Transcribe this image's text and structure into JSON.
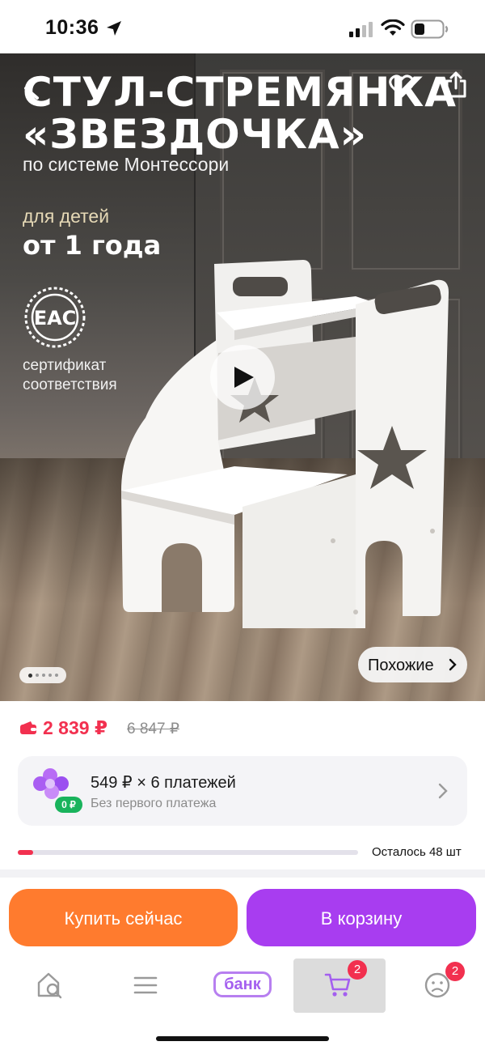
{
  "status_bar": {
    "time": "10:36"
  },
  "hero": {
    "title_line1": "стул-стремянка",
    "title_line2": "«звездочка»",
    "subtitle": "по системе Монтессори",
    "age_prefix": "для детей",
    "age_value": "от 1 года",
    "certificate_text": "сертификат соответствия",
    "badge_mark": "EAC",
    "similar_label": "Похожие",
    "image_count": 5,
    "active_image_index": 0
  },
  "price": {
    "current": "2 839 ₽",
    "old": "6 847 ₽"
  },
  "installment": {
    "title": "549 ₽ × 6 платежей",
    "subtitle": "Без первого платежа",
    "icon_badge": "0 ₽"
  },
  "stock": {
    "label": "Осталось 48 шт",
    "fill_fraction": 0.045
  },
  "actions": {
    "buy_now": "Купить сейчас",
    "add_to_cart": "В корзину"
  },
  "tabbar": {
    "bank_label": "банк",
    "cart_badge": "2",
    "profile_badge": "2",
    "active_tab": "cart"
  },
  "colors": {
    "accent_price": "#f2304f",
    "buy_now": "#ff7b2e",
    "to_cart": "#a83df0",
    "bank": "#a45fef"
  }
}
